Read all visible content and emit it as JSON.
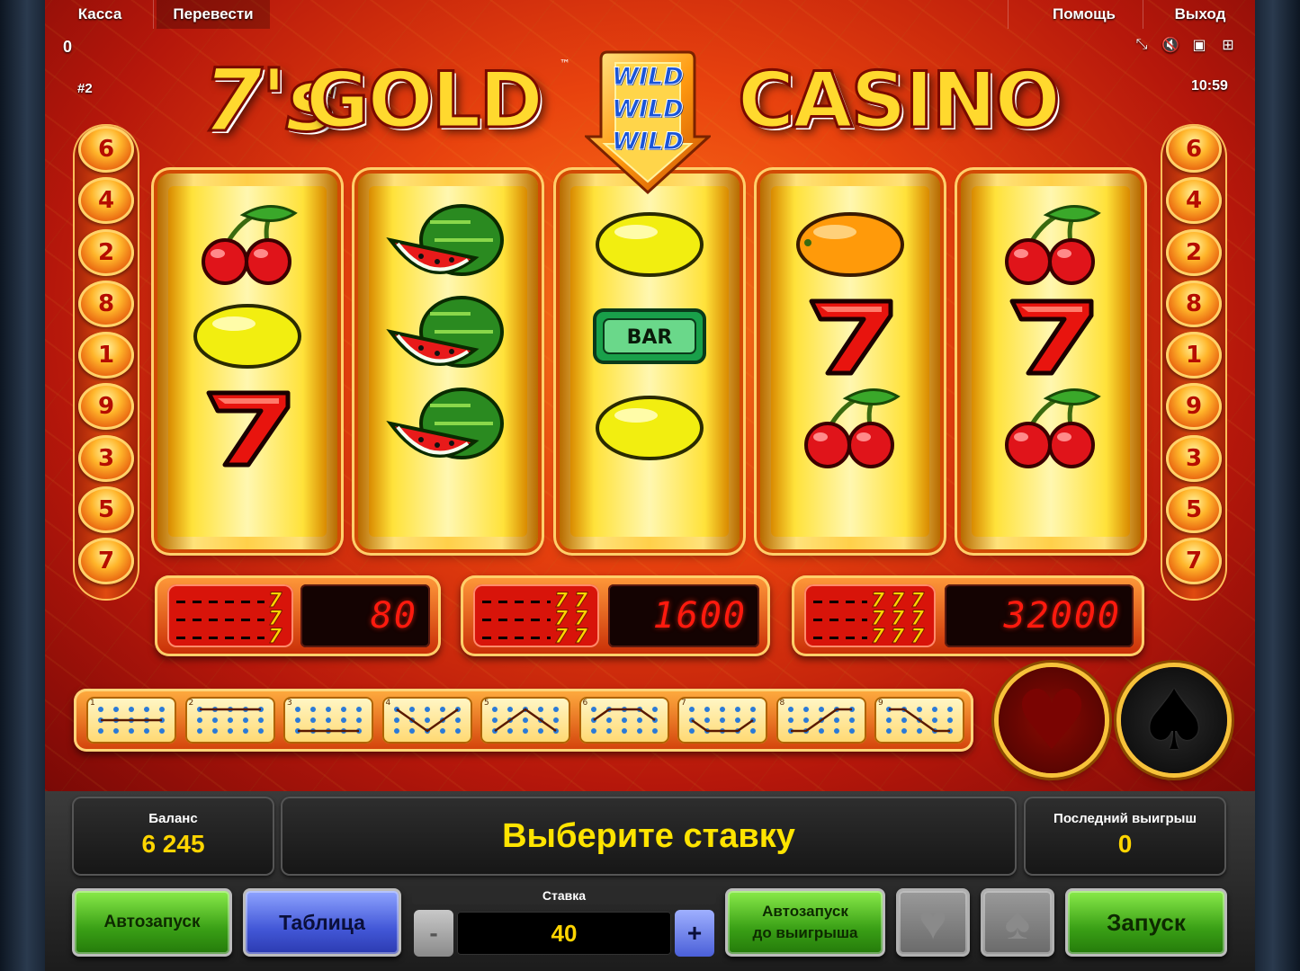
{
  "menu": {
    "cashier": "Касса",
    "translate": "Перевести",
    "help": "Помощь",
    "exit": "Выход"
  },
  "status": {
    "counter": "0",
    "game_number": "#2",
    "clock": "10:59"
  },
  "system_icons": [
    "fullscreen-icon",
    "sound-off-icon",
    "speed-icon",
    "settings-icon"
  ],
  "logo": {
    "sevens": "7's",
    "gold": "GOLD",
    "casino": "CASINO",
    "tm": "™",
    "wild": [
      "WILD",
      "WILD",
      "WILD"
    ]
  },
  "line_numbers": {
    "left": [
      "6",
      "4",
      "2",
      "8",
      "1",
      "9",
      "3",
      "5",
      "7"
    ],
    "right": [
      "6",
      "4",
      "2",
      "8",
      "1",
      "9",
      "3",
      "5",
      "7"
    ]
  },
  "reels": [
    [
      "cherry",
      "lemon",
      "seven"
    ],
    [
      "watermelon",
      "watermelon",
      "watermelon"
    ],
    [
      "lemon",
      "bar",
      "lemon"
    ],
    [
      "orange",
      "seven",
      "cherry"
    ],
    [
      "cherry",
      "seven",
      "cherry"
    ]
  ],
  "bar_symbol_text": "BAR",
  "paytable": [
    {
      "sevens": 1,
      "value": "80"
    },
    {
      "sevens": 2,
      "value": "1600"
    },
    {
      "sevens": 3,
      "value": "32000"
    }
  ],
  "paylines": [
    "1",
    "2",
    "3",
    "4",
    "5",
    "6",
    "7",
    "8",
    "9"
  ],
  "gamble": {
    "red": "red-heart-icon",
    "black": "black-spade-icon"
  },
  "panels": {
    "balance_label": "Баланс",
    "balance_value": "6 245",
    "message": "Выберите ставку",
    "last_win_label": "Последний выигрыш",
    "last_win_value": "0"
  },
  "buttons": {
    "autoplay": "Автозапуск",
    "table": "Таблица",
    "stake_label": "Ставка",
    "stake_value": "40",
    "minus": "-",
    "plus": "+",
    "autoplay_until_win_1": "Автозапуск",
    "autoplay_until_win_2": "до выигрыша",
    "start": "Запуск"
  },
  "colors": {
    "accent_yellow": "#ffe400",
    "button_green": "#3aa016",
    "button_blue": "#4358d8",
    "display_red": "#ff1a0e"
  }
}
